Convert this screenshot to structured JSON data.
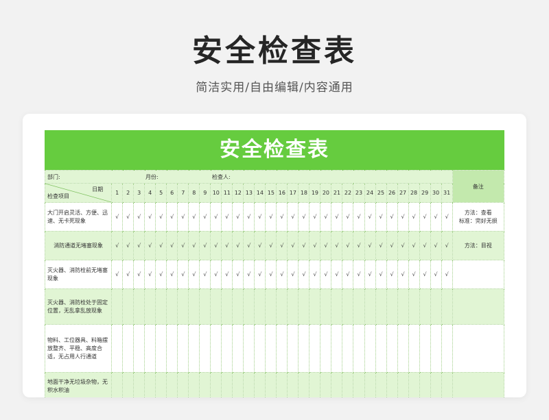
{
  "header": {
    "title": "安全检查表",
    "subtitle": "简洁实用/自由编辑/内容通用"
  },
  "sheet": {
    "banner_title": "安全检查表",
    "info": {
      "department_label": "部门:",
      "month_label": "月份:",
      "inspector_label": "检查人:"
    },
    "diag_date_label": "日期",
    "diag_item_label": "检查项目",
    "remark_header": "备注",
    "days": [
      "1",
      "2",
      "3",
      "4",
      "5",
      "6",
      "7",
      "8",
      "9",
      "10",
      "11",
      "12",
      "13",
      "14",
      "15",
      "16",
      "17",
      "18",
      "19",
      "20",
      "21",
      "22",
      "23",
      "24",
      "25",
      "26",
      "27",
      "28",
      "29",
      "30",
      "31"
    ],
    "check_mark": "√",
    "rows": [
      {
        "item": "大门开启灵活、方便、迅速、无卡死现象",
        "checked": true,
        "remark_lines": [
          "方法：查看",
          "标准：完好无损"
        ],
        "band": "white"
      },
      {
        "item": "消防通道无堵塞现象",
        "checked": true,
        "remark_lines": [
          "方法：目视"
        ],
        "band": "green"
      },
      {
        "item": "灭火器、消防栓前无堵塞现象",
        "checked": true,
        "remark_lines": [],
        "band": "white"
      },
      {
        "item": "灭火器、消防栓处于固定位置，无乱拿乱放现象",
        "checked": false,
        "remark_lines": [],
        "band": "green"
      },
      {
        "item": "物料、工位器具、料箱摆放整齐、平稳、高度合适，无占用人行通道",
        "checked": false,
        "remark_lines": [],
        "band": "white"
      },
      {
        "item": "地面干净无垃圾杂物，无积水积油",
        "checked": false,
        "remark_lines": [],
        "band": "green"
      }
    ]
  }
}
